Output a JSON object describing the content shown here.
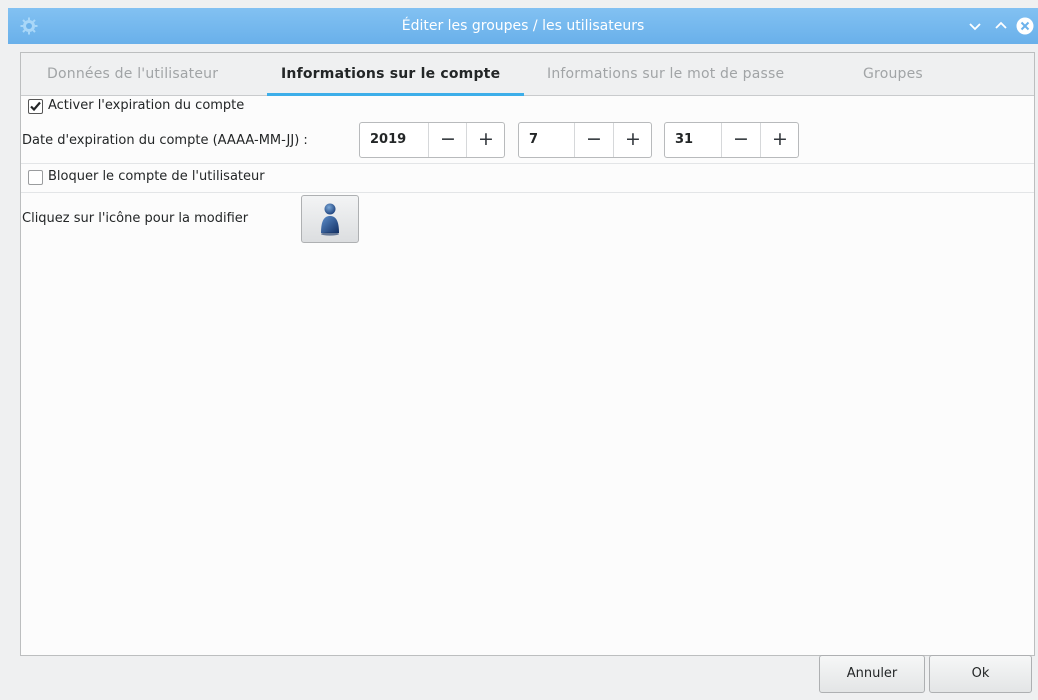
{
  "window": {
    "title": "Éditer les groupes / les utilisateurs",
    "accent": "#6cb2eb"
  },
  "tabs": [
    {
      "label": "Données de l'utilisateur",
      "active": false
    },
    {
      "label": "Informations sur le compte",
      "active": true
    },
    {
      "label": "Informations sur le mot de passe",
      "active": false
    },
    {
      "label": "Groupes",
      "active": false
    }
  ],
  "account": {
    "expiration_checkbox": {
      "label": "Activer l'expiration du compte",
      "checked": true
    },
    "expiration_date_label": "Date d'expiration du compte (AAAA-MM-JJ) :",
    "year": "2019",
    "month": "7",
    "day": "31",
    "decrement_symbol": "−",
    "increment_symbol": "+",
    "lock_checkbox": {
      "label": "Bloquer le compte de l'utilisateur",
      "checked": false
    },
    "icon_label": "Cliquez sur l'icône pour la modifier",
    "user_icon": "user-avatar-icon"
  },
  "buttons": {
    "cancel": "Annuler",
    "ok": "Ok"
  }
}
